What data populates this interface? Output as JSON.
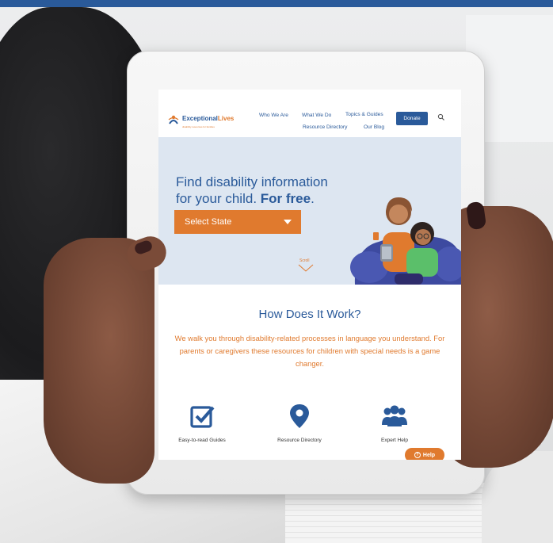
{
  "header": {
    "logo_text_a": "Exceptional",
    "logo_text_b": "Lives",
    "logo_tagline": "disability resources for families"
  },
  "nav": {
    "links": [
      "Who We Are",
      "What We Do",
      "Topics & Guides",
      "Resource Directory",
      "Our Blog"
    ],
    "donate_label": "Donate",
    "search_icon": "search-icon"
  },
  "hero": {
    "title_line1": "Find disability information",
    "title_line2_plain": "for your child. ",
    "title_line2_bold": "For free",
    "title_line2_end": ".",
    "select_label": "Select State",
    "scroll_label": "Scroll"
  },
  "how": {
    "title": "How Does It Work?",
    "body": "We walk you through disability-related processes in language you understand. For parents or caregivers these resources for children with special needs is a game changer."
  },
  "features": [
    {
      "label": "Easy-to-read Guides",
      "icon": "checkbox-icon"
    },
    {
      "label": "Resource Directory",
      "icon": "map-pin-icon"
    },
    {
      "label": "Expert Help",
      "icon": "users-icon"
    }
  ],
  "help": {
    "label": "Help",
    "icon": "question-circle-icon"
  },
  "colors": {
    "brand_blue": "#2a5a9a",
    "brand_orange": "#e07a2e",
    "hero_bg": "#dde6f1"
  }
}
